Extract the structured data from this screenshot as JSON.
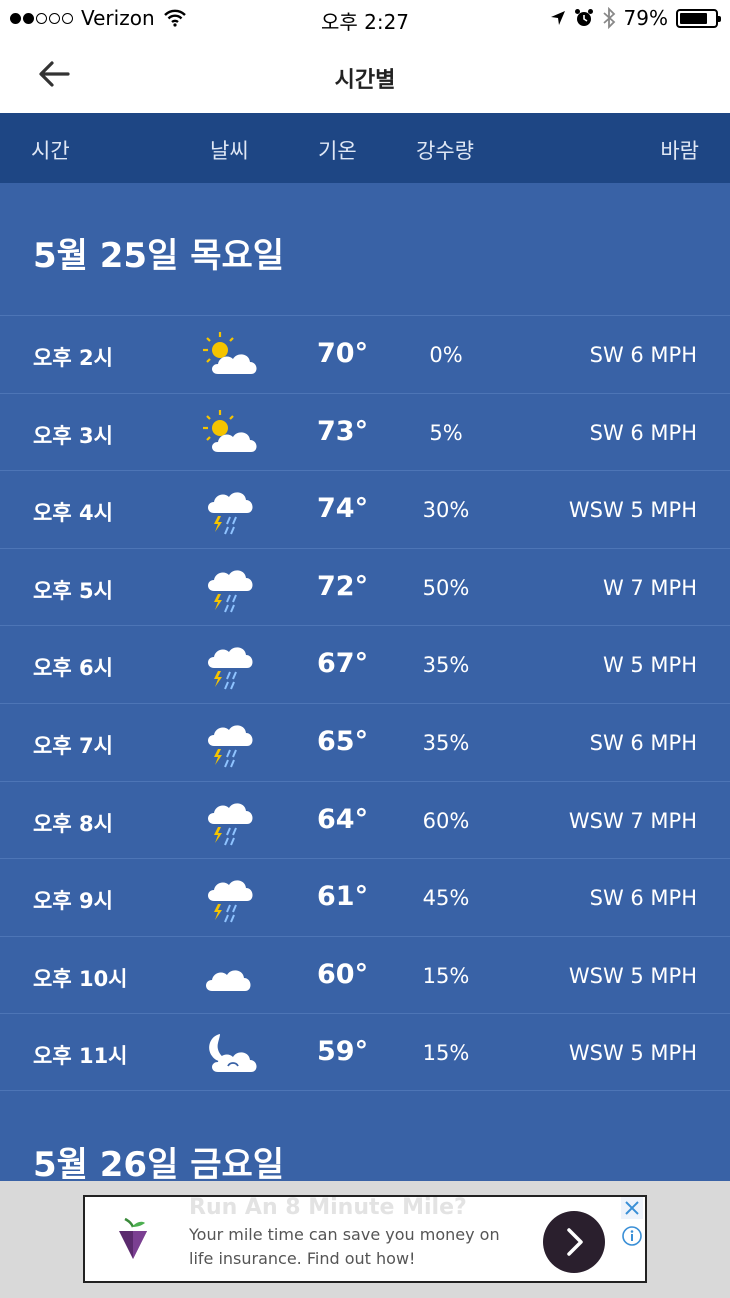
{
  "status_bar": {
    "carrier": "Verizon",
    "time": "오후 2:27",
    "battery": "79%",
    "battery_level": 0.79
  },
  "nav": {
    "title": "시간별"
  },
  "columns": {
    "time": "시간",
    "weather": "날씨",
    "temp": "기온",
    "precip": "강수량",
    "wind": "바람"
  },
  "days": [
    {
      "label": "5월 25일 목요일"
    },
    {
      "label": "5월 26일 금요일"
    }
  ],
  "hours": [
    {
      "time": "오후 2시",
      "icon": "partly-sunny-icon",
      "temp": "70°",
      "precip": "0%",
      "wind": "SW 6 MPH"
    },
    {
      "time": "오후 3시",
      "icon": "partly-sunny-icon",
      "temp": "73°",
      "precip": "5%",
      "wind": "SW 6 MPH"
    },
    {
      "time": "오후 4시",
      "icon": "thunderstorm-icon",
      "temp": "74°",
      "precip": "30%",
      "wind": "WSW 5 MPH"
    },
    {
      "time": "오후 5시",
      "icon": "thunderstorm-icon",
      "temp": "72°",
      "precip": "50%",
      "wind": "W 7 MPH"
    },
    {
      "time": "오후 6시",
      "icon": "thunderstorm-icon",
      "temp": "67°",
      "precip": "35%",
      "wind": "W 5 MPH"
    },
    {
      "time": "오후 7시",
      "icon": "thunderstorm-icon",
      "temp": "65°",
      "precip": "35%",
      "wind": "SW 6 MPH"
    },
    {
      "time": "오후 8시",
      "icon": "thunderstorm-icon",
      "temp": "64°",
      "precip": "60%",
      "wind": "WSW 7 MPH"
    },
    {
      "time": "오후 9시",
      "icon": "thunderstorm-icon",
      "temp": "61°",
      "precip": "45%",
      "wind": "SW 6 MPH"
    },
    {
      "time": "오후 10시",
      "icon": "cloudy-icon",
      "temp": "60°",
      "precip": "15%",
      "wind": "WSW 5 MPH"
    },
    {
      "time": "오후 11시",
      "icon": "partly-cloudy-night-icon",
      "temp": "59°",
      "precip": "15%",
      "wind": "WSW 5 MPH"
    }
  ],
  "ad": {
    "headline": "Run An 8 Minute Mile?",
    "text": "Your mile time can save you money on life insurance. Find out how!"
  }
}
